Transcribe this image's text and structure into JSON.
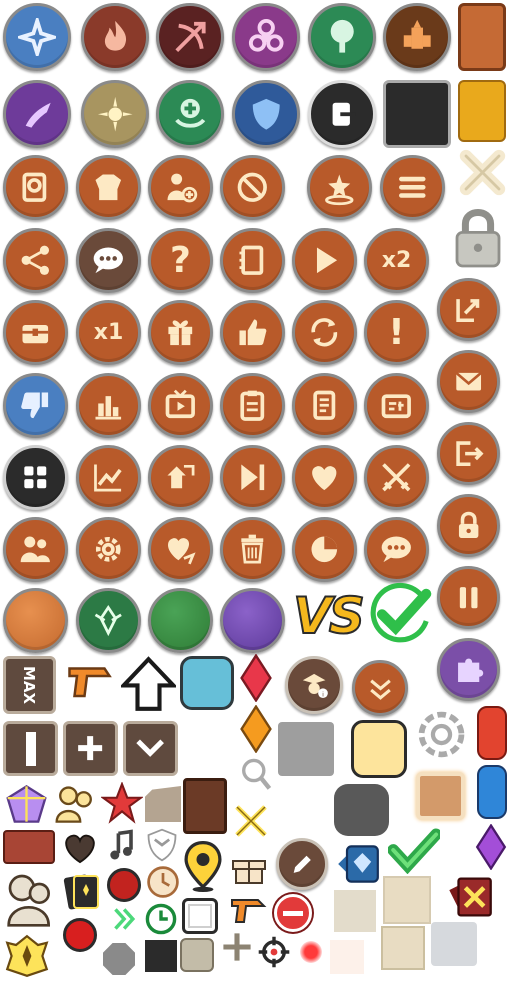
{
  "sheet": {
    "labels": {
      "x2": "x2",
      "x1": "x1",
      "max": "MAX",
      "vs": "VS"
    }
  },
  "colors": {
    "brown": "#b85a2a",
    "blue": "#4a7fc1",
    "purple": "#7b4fa8",
    "green": "#2c8a55",
    "dark": "#2b2b2b",
    "cream": "#fde9c4",
    "gold": "#e9a91c"
  },
  "icons": [
    "crystal-class-icon",
    "fire-class-icon",
    "bow-class-icon",
    "biohazard-class-icon",
    "tree-class-icon",
    "tower-class-icon",
    "claw-class-icon",
    "sun-class-icon",
    "heal-class-icon",
    "shield-class-icon",
    "exit-icon",
    "search-document-icon",
    "armor-icon",
    "add-user-icon",
    "ban-icon",
    "summon-icon",
    "menu-icon",
    "share-icon",
    "chat-icon",
    "help-icon",
    "notebook-icon",
    "play-icon",
    "gift-chest-icon",
    "gift-icon",
    "thumbs-up-icon",
    "refresh-icon",
    "alert-icon",
    "thumbs-down-icon",
    "bar-chart-icon",
    "tv-icon",
    "clipboard-icon",
    "contract-icon",
    "id-card-icon",
    "grid-icon",
    "line-chart-icon",
    "hero-swap-icon",
    "skip-icon",
    "heart-icon",
    "crossed-swords-icon",
    "user-group-icon",
    "settings-icon",
    "heart-share-icon",
    "trash-icon",
    "pie-chart-icon",
    "speech-icon",
    "close-icon",
    "lock-icon",
    "login-icon",
    "mail-icon",
    "logout-icon",
    "pause-icon",
    "puzzle-icon",
    "arrow-up-icon",
    "chevron-down-icon",
    "double-chevron-down-icon",
    "magnify-icon",
    "pencil-icon",
    "checkmark-icon",
    "location-pin-icon",
    "target-icon",
    "clock-icon",
    "music-icon",
    "star-icon",
    "gem-icon",
    "card-icon",
    "minus-icon",
    "plus-icon"
  ]
}
